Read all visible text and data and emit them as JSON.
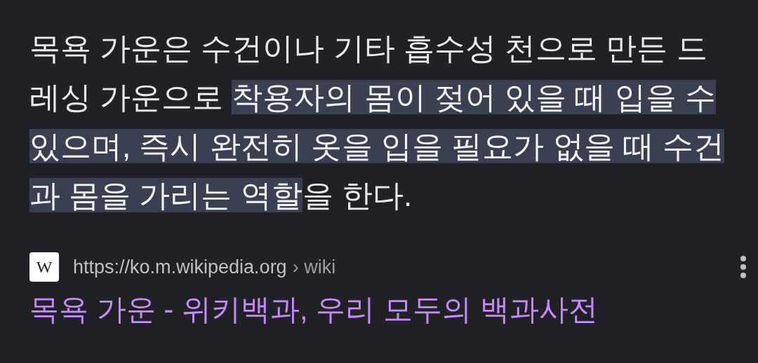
{
  "snippet": {
    "before": "목욕 가운은 수건이나 기타 흡수성 천으로 만든 드레싱 가운으로 ",
    "highlighted": "착용자의 몸이 젖어 있을 때 입을 수 있으며, 즉시 완전히 옷을 입을 필요가 없을 때 수건과 몸을 가리는 역할",
    "after": "을 한다."
  },
  "source": {
    "favicon": "W",
    "url": "https://ko.m.wikipedia.org",
    "path": "› wiki"
  },
  "result": {
    "title": "목욕 가운 - 위키백과, 우리 모두의 백과사전",
    "visited": true
  }
}
